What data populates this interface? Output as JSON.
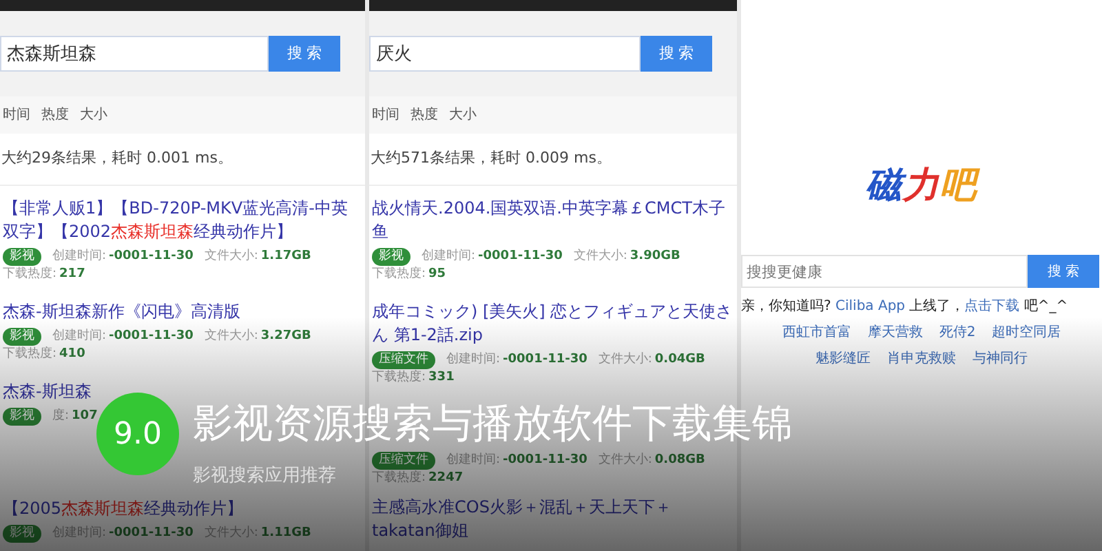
{
  "panels": [
    {
      "kind": "results",
      "query": "杰森斯坦森",
      "button": "搜 索",
      "sorts": [
        "时间",
        "热度",
        "大小"
      ],
      "summary": "大约29条结果，耗时 0.001 ms。",
      "results": [
        {
          "segments": [
            {
              "text": "【非常人贩1】【BD-720P-MKV蓝光高清-中英双字】【2002",
              "highlight": false
            },
            {
              "text": "杰森斯坦森",
              "highlight": true
            },
            {
              "text": "经典动作片】",
              "highlight": false
            }
          ],
          "tag": "影视",
          "created_label": "创建时间:",
          "created": "-0001-11-30",
          "size_label": "文件大小:",
          "size": "1.17GB",
          "heat_label": "下载热度:",
          "heat": "217"
        },
        {
          "segments": [
            {
              "text": "杰森-斯坦森新作《闪电》高清版",
              "highlight": false
            }
          ],
          "tag": "影视",
          "created_label": "创建时间:",
          "created": "-0001-11-30",
          "size_label": "文件大小:",
          "size": "3.27GB",
          "heat_label": "下载热度:",
          "heat": "410"
        },
        {
          "segments": [
            {
              "text": "杰森-斯坦森",
              "highlight": false
            }
          ],
          "tag": "影视",
          "heat_label": "度:",
          "heat": "107"
        },
        {
          "bottom": true,
          "segments": [
            {
              "text": "【2005",
              "highlight": false
            },
            {
              "text": "杰森斯坦森",
              "highlight": true
            },
            {
              "text": "经典动作片】",
              "highlight": false
            }
          ],
          "tag": "影视",
          "created_label": "创建时间:",
          "created": "-0001-11-30",
          "size_label": "文件大小:",
          "size": "1.11GB"
        }
      ]
    },
    {
      "kind": "results",
      "query": "厌火",
      "button": "搜 索",
      "sorts": [
        "时间",
        "热度",
        "大小"
      ],
      "summary": "大约571条结果，耗时 0.009 ms。",
      "results": [
        {
          "segments": [
            {
              "text": "战火情天.2004.国英双语.中英字幕￡CMCT木子鱼",
              "highlight": false
            }
          ],
          "tag": "影视",
          "created_label": "创建时间:",
          "created": "-0001-11-30",
          "size_label": "文件大小:",
          "size": "3.90GB",
          "heat_label": "下载热度:",
          "heat": "95"
        },
        {
          "segments": [
            {
              "text": "成年コミック) [美矢火] 恋とフィギュアと天使さん 第1-2話.zip",
              "highlight": false
            }
          ],
          "tag": "压缩文件",
          "created_label": "创建时间:",
          "created": "-0001-11-30",
          "size_label": "文件大小:",
          "size": "0.04GB",
          "heat_label": "下载热度:",
          "heat": "331"
        },
        {
          "bottom": true,
          "tag": "压缩文件",
          "created_label": "创建时间:",
          "created": "-0001-11-30",
          "size_label": "文件大小:",
          "size": "0.08GB",
          "heat_label": "下载热度:",
          "heat": "2247"
        },
        {
          "bottom": true,
          "segments": [
            {
              "text": "主感高水准COS火影＋混乱＋天上天下＋takatan御姐",
              "highlight": false
            }
          ]
        }
      ]
    },
    {
      "kind": "home",
      "logo": [
        {
          "text": "磁",
          "color": "#2456c8"
        },
        {
          "text": "力",
          "color": "#e0302c"
        },
        {
          "text": "吧",
          "color": "#eea020"
        }
      ],
      "placeholder": "搜搜更健康",
      "button": "搜 索",
      "notice": [
        {
          "text": "亲，你知道吗? ",
          "link": false
        },
        {
          "text": "Ciliba App",
          "link": true
        },
        {
          "text": " 上线了，",
          "link": false
        },
        {
          "text": "点击下载",
          "link": true
        },
        {
          "text": " 吧^_^",
          "link": false
        }
      ],
      "hot": [
        [
          "西虹市首富",
          "摩天营救",
          "死侍2",
          "超时空同居"
        ],
        [
          "魅影缝匠",
          "肖申克救赎",
          "与神同行"
        ]
      ]
    }
  ],
  "score": "9.0",
  "title": "影视资源搜索与播放软件下载集锦",
  "subtitle": "影视搜索应用推荐"
}
